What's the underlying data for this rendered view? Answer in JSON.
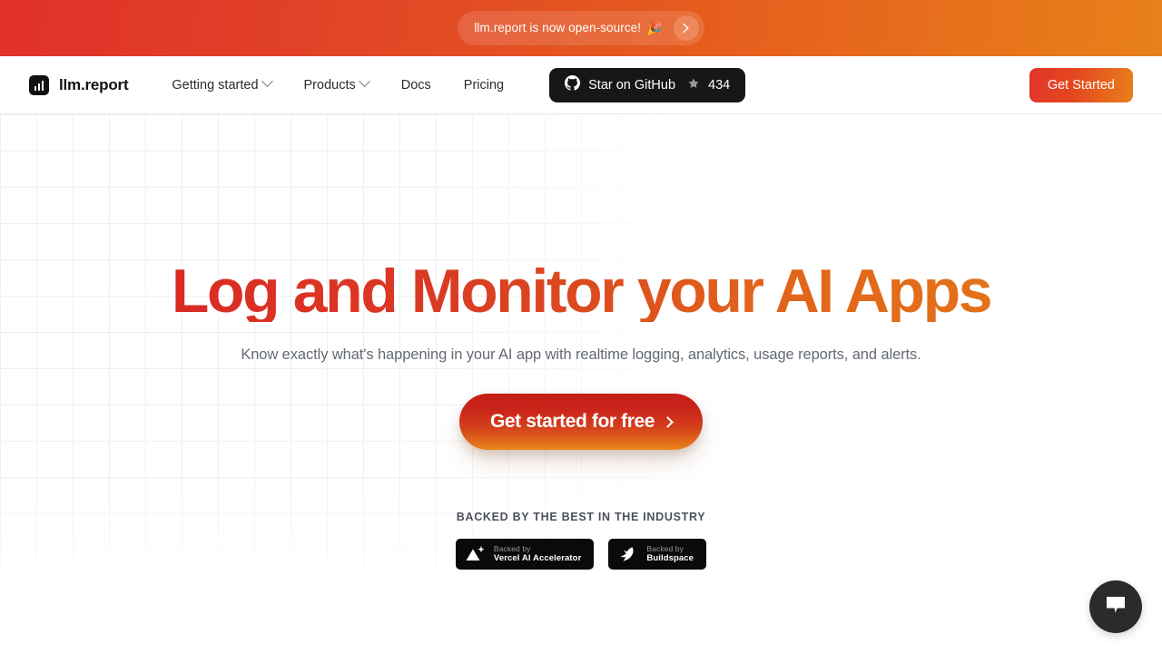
{
  "banner": {
    "text": "llm.report is now open-source!",
    "emoji": "🎉",
    "arrow_icon": "chevron-right-icon"
  },
  "header": {
    "brand": {
      "name": "llm.report",
      "logo_icon": "bar-chart-logo-icon"
    },
    "nav": [
      {
        "label": "Getting started",
        "has_dropdown": true
      },
      {
        "label": "Products",
        "has_dropdown": true
      },
      {
        "label": "Docs",
        "has_dropdown": false
      },
      {
        "label": "Pricing",
        "has_dropdown": false
      }
    ],
    "github": {
      "icon": "github-icon",
      "label": "Star on GitHub",
      "star_icon": "star-icon",
      "count": "434"
    },
    "cta": {
      "label": "Get Started"
    }
  },
  "hero": {
    "headline": "Log and Monitor your AI Apps",
    "subheadline": "Know exactly what's happening in your AI app with realtime logging, analytics, usage reports, and alerts.",
    "cta_label": "Get started for free",
    "cta_arrow_icon": "chevron-right-icon"
  },
  "backed_by": {
    "title": "BACKED BY THE BEST IN THE INDUSTRY",
    "badges": [
      {
        "logo_icon": "vercel-triangle-icon",
        "sub": "Backed by",
        "main": "Vercel AI Accelerator"
      },
      {
        "logo_icon": "buildspace-arrow-icon",
        "sub": "Backed by",
        "main": "Buildspace"
      }
    ]
  },
  "chat_widget": {
    "icon": "chat-bubble-icon"
  },
  "colors": {
    "brand_red": "#da2a23",
    "brand_orange": "#e8801a",
    "banner_gradient_start": "#e0302a",
    "banner_gradient_end": "#e8801a",
    "dark": "#171717",
    "subtext": "#646a73"
  }
}
